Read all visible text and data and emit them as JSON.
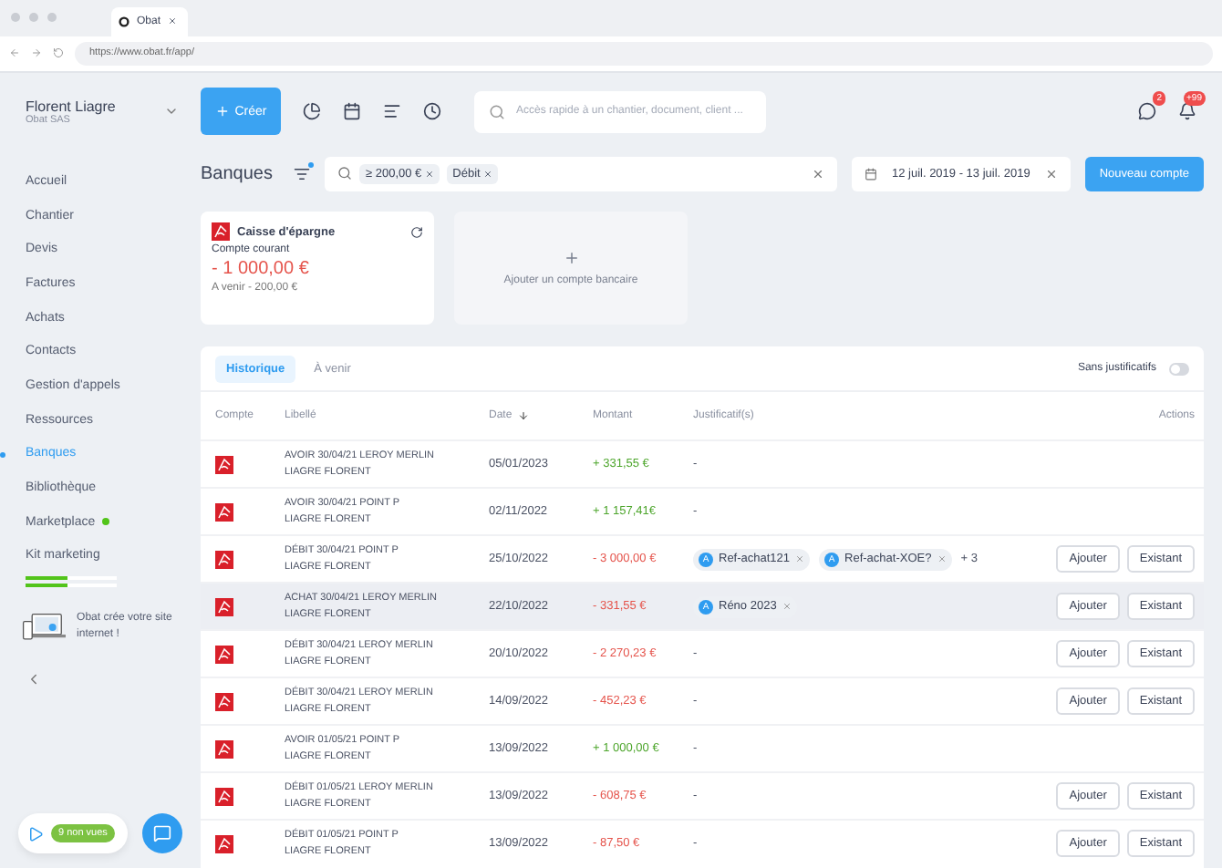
{
  "browser": {
    "tab": {
      "title": "Obat"
    },
    "url": "https://www.obat.fr/app/"
  },
  "topbar": {
    "user": {
      "name": "Florent Liagre",
      "company": "Obat SAS"
    },
    "create_button": "Créer",
    "search": {
      "placeholder": "Accès rapide à un chantier, document, client ..."
    },
    "messages_badge": "2",
    "notifications_badge": "+99"
  },
  "sidebar": {
    "items": [
      {
        "label": "Accueil",
        "selected": false,
        "dot": false
      },
      {
        "label": "Chantier",
        "selected": false,
        "dot": false
      },
      {
        "label": "Devis",
        "selected": false,
        "dot": false
      },
      {
        "label": "Factures",
        "selected": false,
        "dot": false
      },
      {
        "label": "Achats",
        "selected": false,
        "dot": false
      },
      {
        "label": "Contacts",
        "selected": false,
        "dot": false
      },
      {
        "label": "Gestion d'appels",
        "selected": false,
        "dot": false
      },
      {
        "label": "Ressources",
        "selected": false,
        "dot": false
      },
      {
        "label": "Banques",
        "selected": true,
        "dot": false
      },
      {
        "label": "Bibliothèque",
        "selected": false,
        "dot": false
      },
      {
        "label": "Marketplace",
        "selected": false,
        "dot": true
      },
      {
        "label": "Kit marketing",
        "selected": false,
        "dot": false
      }
    ],
    "kit_progress": [
      {
        "level": 0.45
      },
      {
        "level": 0.45
      }
    ],
    "promo": "Obat crée votre site internet !",
    "videos_badge": "9 non vues"
  },
  "page": {
    "title": "Banques",
    "filter_active": true,
    "filters": [
      "≥ 200,00 €",
      "Débit"
    ],
    "date_range": "12 juil. 2019 - 13 juil. 2019",
    "new_account_button": "Nouveau compte"
  },
  "account_card": {
    "bank": "Caisse d'épargne",
    "account": "Compte courant",
    "balance": "- 1 000,00 €",
    "upcoming": "A venir - 200,00 €"
  },
  "add_account": "Ajouter un compte bancaire",
  "table": {
    "tabs": [
      {
        "label": "Historique",
        "selected": true
      },
      {
        "label": "À venir",
        "selected": false
      }
    ],
    "toggle": {
      "label": "Sans justificatifs",
      "on": false
    },
    "columns": [
      "Compte",
      "Libellé",
      "Date",
      "Montant",
      "Justificatif(s)",
      "Actions"
    ],
    "rows": [
      {
        "label": [
          "AVOIR 30/04/21 LEROY MERLIN",
          "LIAGRE FLORENT"
        ],
        "date": "05/01/2023",
        "amount": "+ 331,55 €",
        "kind": "credit",
        "documents": [],
        "more": "",
        "empty": "-",
        "actions": []
      },
      {
        "label": [
          "AVOIR 30/04/21 POINT P",
          "LIAGRE FLORENT"
        ],
        "date": "02/11/2022",
        "amount": "+ 1 157,41€",
        "kind": "credit",
        "documents": [],
        "more": "",
        "empty": "-",
        "actions": []
      },
      {
        "label": [
          "DÉBIT 30/04/21 POINT P",
          "LIAGRE FLORENT"
        ],
        "date": "25/10/2022",
        "amount": "- 3 000,00 €",
        "kind": "debit",
        "documents": [
          {
            "avatar": "A",
            "name": "Ref-achat121"
          },
          {
            "avatar": "A",
            "name": "Ref-achat-XOE?"
          }
        ],
        "more": "+ 3",
        "empty": "",
        "actions": [
          "Ajouter",
          "Existant"
        ]
      },
      {
        "label": [
          "ACHAT 30/04/21 LEROY MERLIN",
          "LIAGRE FLORENT"
        ],
        "date": "22/10/2022",
        "amount": "- 331,55 €",
        "kind": "debit",
        "hovered": true,
        "documents": [
          {
            "avatar": "A",
            "name": "Réno 2023"
          }
        ],
        "more": "",
        "empty": "",
        "actions": [
          "Ajouter",
          "Existant"
        ]
      },
      {
        "label": [
          "DÉBIT 30/04/21 LEROY MERLIN",
          "LIAGRE FLORENT"
        ],
        "date": "20/10/2022",
        "amount": "- 2 270,23 €",
        "kind": "debit",
        "documents": [],
        "more": "",
        "empty": "-",
        "actions": [
          "Ajouter",
          "Existant"
        ]
      },
      {
        "label": [
          "DÉBIT 30/04/21 LEROY MERLIN",
          "LIAGRE FLORENT"
        ],
        "date": "14/09/2022",
        "amount": "- 452,23 €",
        "kind": "debit",
        "documents": [],
        "more": "",
        "empty": "-",
        "actions": [
          "Ajouter",
          "Existant"
        ]
      },
      {
        "label": [
          "AVOIR 01/05/21 POINT P",
          "LIAGRE FLORENT"
        ],
        "date": "13/09/2022",
        "amount": "+ 1 000,00 €",
        "kind": "credit",
        "documents": [],
        "more": "",
        "empty": "-",
        "actions": []
      },
      {
        "label": [
          "DÉBIT 01/05/21 LEROY MERLIN",
          "LIAGRE FLORENT"
        ],
        "date": "13/09/2022",
        "amount": "- 608,75 €",
        "kind": "debit",
        "documents": [],
        "more": "",
        "empty": "-",
        "actions": [
          "Ajouter",
          "Existant"
        ]
      },
      {
        "label": [
          "DÉBIT 01/05/21 POINT P",
          "LIAGRE FLORENT"
        ],
        "date": "13/09/2022",
        "amount": "- 87,50 €",
        "kind": "debit",
        "documents": [],
        "more": "",
        "empty": "-",
        "actions": [
          "Ajouter",
          "Existant"
        ]
      }
    ]
  }
}
